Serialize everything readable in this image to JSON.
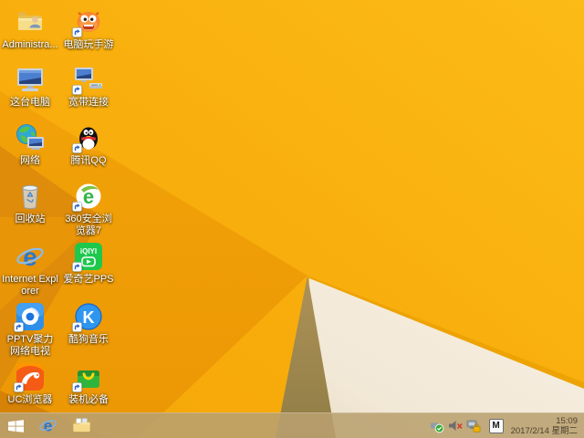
{
  "desktop": {
    "icons": [
      {
        "id": "administrator",
        "label": "Administra...",
        "glyph": "folder-user",
        "col": 1,
        "row": 0,
        "shortcut": false
      },
      {
        "id": "pc-mobile-games",
        "label": "电脑玩手游",
        "glyph": "monster",
        "col": 2,
        "row": 0,
        "shortcut": true
      },
      {
        "id": "this-pc",
        "label": "这台电脑",
        "glyph": "computer",
        "col": 1,
        "row": 1,
        "shortcut": false
      },
      {
        "id": "broadband-connection",
        "label": "宽带连接",
        "glyph": "broadband",
        "col": 2,
        "row": 1,
        "shortcut": true
      },
      {
        "id": "network",
        "label": "网络",
        "glyph": "globe-network",
        "col": 1,
        "row": 2,
        "shortcut": false
      },
      {
        "id": "tencent-qq",
        "label": "腾讯QQ",
        "glyph": "qq-penguin",
        "col": 2,
        "row": 2,
        "shortcut": true
      },
      {
        "id": "recycle-bin",
        "label": "回收站",
        "glyph": "recycle-bin",
        "col": 1,
        "row": 3,
        "shortcut": false
      },
      {
        "id": "360-safe-browser",
        "label": "360安全浏览器7",
        "glyph": "browser-360",
        "col": 2,
        "row": 3,
        "shortcut": true
      },
      {
        "id": "internet-explorer",
        "label": "Internet Explorer",
        "glyph": "ie",
        "col": 1,
        "row": 4,
        "shortcut": false
      },
      {
        "id": "iqiyi-pps",
        "label": "爱奇艺PPS",
        "glyph": "iqiyi",
        "col": 2,
        "row": 4,
        "shortcut": true
      },
      {
        "id": "pptv",
        "label": "PPTV聚力 网络电视",
        "glyph": "pptv",
        "col": 1,
        "row": 5,
        "shortcut": true
      },
      {
        "id": "kugou-music",
        "label": "酷狗音乐",
        "glyph": "kugou",
        "col": 2,
        "row": 5,
        "shortcut": true
      },
      {
        "id": "uc-browser",
        "label": "UC浏览器",
        "glyph": "uc",
        "col": 1,
        "row": 6,
        "shortcut": true
      },
      {
        "id": "essential-apps",
        "label": "装机必备",
        "glyph": "app-bag",
        "col": 2,
        "row": 6,
        "shortcut": true
      }
    ]
  },
  "taskbar": {
    "buttons": [
      {
        "id": "start",
        "glyph": "windows-flag"
      },
      {
        "id": "internet-explorer",
        "glyph": "ie-task"
      },
      {
        "id": "file-explorer",
        "glyph": "explorer-folder"
      }
    ],
    "tray": [
      {
        "id": "safely-remove-hardware",
        "glyph": "usb-check"
      },
      {
        "id": "volume-muted",
        "glyph": "speaker-mute"
      },
      {
        "id": "hardware-alert",
        "glyph": "device-lock"
      },
      {
        "id": "input-method-indicator",
        "label": "M"
      }
    ],
    "clock": {
      "time": "15:09",
      "date": "2017/2/14 星期二"
    }
  },
  "wallpaper": {
    "base_top": "#FCBB17",
    "base_bottom": "#F5A608",
    "facet_left": "#F09D05",
    "facet_left_dark": "#DE8C09",
    "facet_corner": "#D68207",
    "fold_edge": "#EDA303",
    "fold_khaki_top": "#AE9258",
    "fold_khaki_bottom": "#8F7D45",
    "fold_cream": "#F4ECDD",
    "fold_cream_shade": "#E9DDC6",
    "taskbar_tint": "rgba(186,160,112,0.88)"
  }
}
